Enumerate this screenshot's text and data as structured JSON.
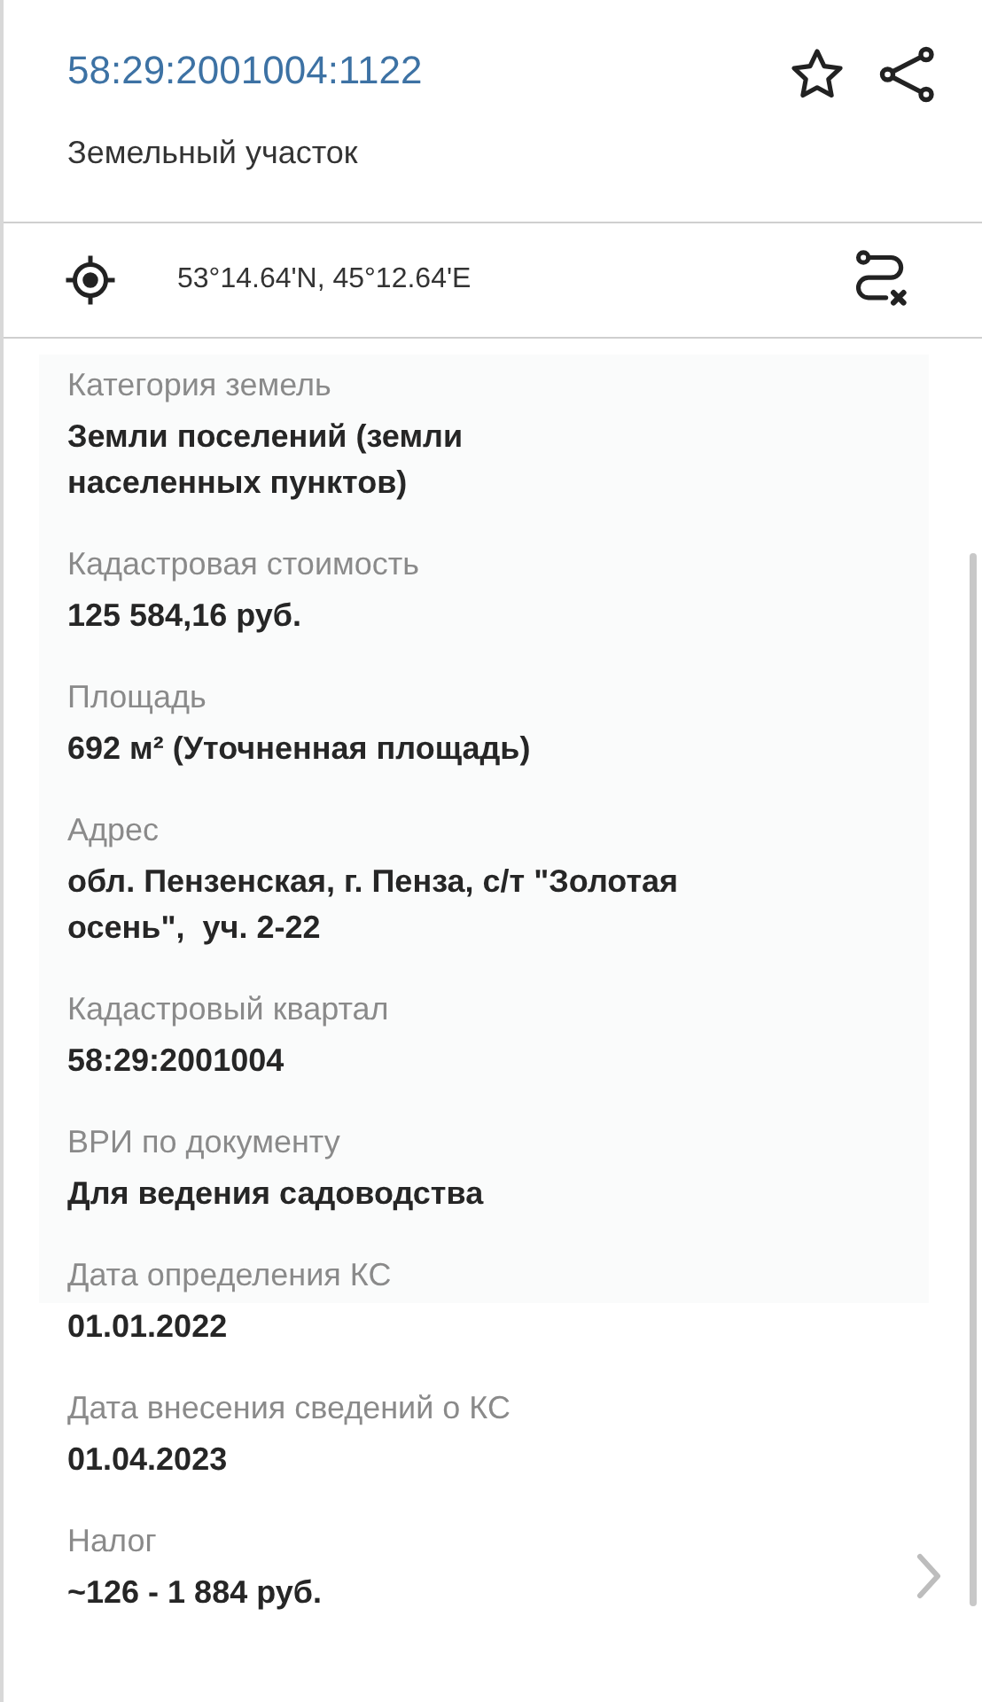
{
  "header": {
    "cadastral_number": "58:29:2001004:1122",
    "object_type": "Земельный участок"
  },
  "coordinates": "53°14.64'N, 45°12.64'E",
  "fields": [
    {
      "kind": "plain",
      "label": "Категория земель",
      "value": "Земли поселений (земли\nнаселенных пунктов)"
    },
    {
      "kind": "plain",
      "label": "Кадастровая стоимость",
      "value": "125 584,16 руб."
    },
    {
      "kind": "plain",
      "label": "Площадь",
      "value": "692 м² (Уточненная площадь)"
    },
    {
      "kind": "plain",
      "label": "Адрес",
      "value": "обл. Пензенская, г. Пенза, с/т \"Золотая\nосень\",  уч. 2-22"
    },
    {
      "kind": "plain",
      "label": "Кадастровый квартал",
      "value": "58:29:2001004"
    },
    {
      "kind": "plain",
      "label": "ВРИ по документу",
      "value": "Для ведения садоводства"
    },
    {
      "kind": "plain",
      "label": "Дата определения КС",
      "value": "01.01.2022"
    },
    {
      "kind": "plain",
      "label": "Дата внесения сведений о КС",
      "value": "01.04.2023"
    },
    {
      "kind": "link",
      "label": "Налог",
      "value": "~126 - 1 884 руб."
    }
  ]
}
